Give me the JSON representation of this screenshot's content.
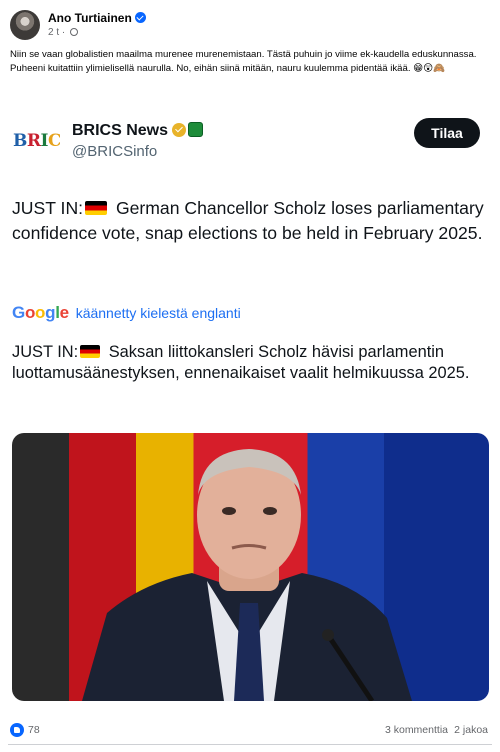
{
  "post": {
    "author": "Ano Turtiainen",
    "time": "2 t",
    "meta_separator": "·",
    "text": "Niin se vaan globalistien maailma murenee murenemistaan. Tästä puhuin jo viime ek-kaudella eduskunnassa. Puheeni kuitattiin ylimielisellä naurulla. No, eihän siinä mitään, nauru kuulemma pidentää ikää. 😁😲🙈"
  },
  "shared": {
    "logo_text": "BRICS",
    "account_name": "BRICS News",
    "account_handle": "@BRICSinfo",
    "subscribe_label": "Tilaa",
    "tweet_prefix": "JUST IN:",
    "tweet_body": "German Chancellor Scholz loses parliamentary confidence vote, snap elections to be held in February 2025.",
    "translated_by": "käännetty kielestä englanti",
    "google_letters": [
      "G",
      "o",
      "o",
      "g",
      "l",
      "e"
    ],
    "translated_prefix": "JUST IN:",
    "translated_body": "Saksan liittokansleri Scholz hävisi parlamentin luottamusäänestyksen, ennenaikaiset vaalit helmikuussa 2025."
  },
  "footer": {
    "reaction_count": "78",
    "comments": "3 kommenttia",
    "shares": "2 jakoa"
  },
  "colors": {
    "facebook_blue": "#0866ff",
    "google_blue": "#4285f4",
    "google_red": "#ea4335",
    "google_yellow": "#fbbc05",
    "google_green": "#34a853",
    "subscribe_bg": "#0f1419"
  }
}
